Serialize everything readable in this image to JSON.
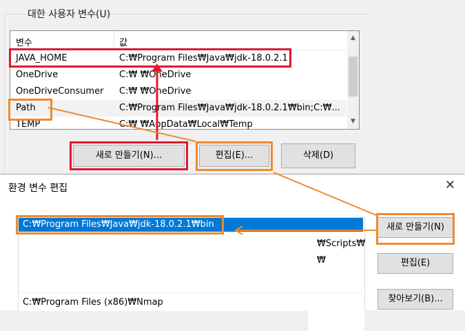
{
  "user_vars": {
    "group_title": "대한 사용자 변수(U)",
    "columns": [
      "변수",
      "값"
    ],
    "rows": [
      {
        "name": "JAVA_HOME",
        "value": "C:₩Program Files₩Java₩jdk-18.0.2.1"
      },
      {
        "name": "OneDrive",
        "value": "C:₩                    ₩OneDrive"
      },
      {
        "name": "OneDriveConsumer",
        "value": "C:₩                    ₩OneDrive"
      },
      {
        "name": "Path",
        "value": "C:₩Program Files₩Java₩jdk-18.0.2.1₩bin;C:₩..."
      },
      {
        "name": "TEMP",
        "value": "C:₩                       ₩AppData₩Local₩Temp"
      }
    ],
    "buttons": {
      "new": "새로 만들기(N)...",
      "edit": "편집(E)...",
      "delete": "삭제(D)"
    }
  },
  "edit_dialog": {
    "title": "환경 변수 편집",
    "close_glyph": "✕",
    "selected_entry": "C:₩Program Files₩Java₩jdk-18.0.2.1₩bin",
    "entries": [
      "₩Scripts₩",
      "₩",
      "C:₩Program Files (x86)₩Nmap"
    ],
    "buttons": {
      "new": "새로 만들기(N)",
      "edit": "편집(E)",
      "browse": "찾아보기(B)..."
    }
  },
  "annotation_colors": {
    "red": "#e0182d",
    "orange": "#f08a2a"
  }
}
